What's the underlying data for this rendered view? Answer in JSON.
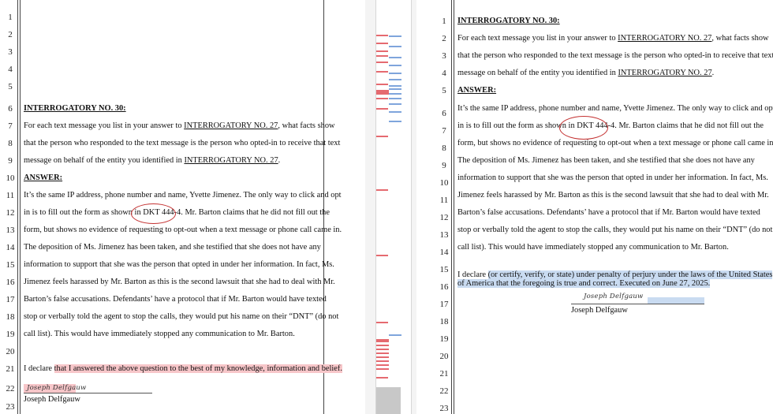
{
  "left": {
    "line_numbers": [
      "1",
      "2",
      "3",
      "4",
      "5",
      "6",
      "7",
      "8",
      "9",
      "10",
      "11",
      "12",
      "13",
      "14",
      "15",
      "16",
      "17",
      "18",
      "19",
      "20",
      "21",
      "22",
      "23"
    ],
    "heading": "INTERROGATORY NO. 30:",
    "q1_pre": "For each text message you list in your answer to ",
    "q1_ref": "INTERROGATORY NO. 27",
    "q1_post": ", what facts show",
    "q2": "that the person who responded to the text message is the person who opted-in to receive that text",
    "q3_pre": "message on behalf of the entity you identified in ",
    "q3_ref": "INTERROGATORY NO. 27",
    "q3_post": ".",
    "answer_heading": "ANSWER:",
    "a1": "It’s the same IP address, phone number and name, Yvette Jimenez. The only way to click and opt",
    "a2_pre": "in is to fill out the form as shown in ",
    "a2_ref": "DKT 444-4.",
    "a2_post": "  Mr. Barton claims that he did not fill out the",
    "a3": "form, but shows no evidence of requesting to opt-out when a text message or phone call came in.",
    "a4": "The deposition of Ms. Jimenez has been taken, and she testified that she does not have any",
    "a5": "information to support that she was the person that opted in under her information.  In fact, Ms.",
    "a6": "Jimenez feels harassed by Mr. Barton as this is the second lawsuit that she had to deal with Mr.",
    "a7": "Barton’s false accusations.    Defendants’ have a protocol that if Mr. Barton would have texted",
    "a8": "stop or verbally told the agent to stop the calls, they would put his name on their “DNT” (do not",
    "a9": "call list). This would have immediately stopped any communication to Mr. Barton.",
    "declare_pre": "I declare ",
    "declare_hl": "that I answered the above question to the best of my knowledge, information and belief.",
    "signature": "Joseph Delfgauw",
    "signer": "Joseph Delfgauw"
  },
  "right": {
    "line_numbers": [
      "1",
      "2",
      "3",
      "4",
      "5",
      "6",
      "7",
      "8",
      "9",
      "10",
      "11",
      "12",
      "13",
      "14",
      "15",
      "16",
      "17",
      "18",
      "19",
      "20",
      "21",
      "22",
      "23"
    ],
    "heading": "INTERROGATORY NO. 30:",
    "q1_pre": "For each text message you list in your answer to ",
    "q1_ref": "INTERROGATORY NO. 27",
    "q1_post": ", what facts show",
    "q2": "that the person who responded to the text message is the person who opted-in to receive that text",
    "q3_pre": "message on behalf of the entity you identified in ",
    "q3_ref": "INTERROGATORY NO. 27",
    "q3_post": ".",
    "answer_heading": "ANSWER:",
    "a1": "It’s the same IP address, phone number and name, Yvette Jimenez. The only way to click and opt",
    "a2_pre": "in is to fill out the form as shown in ",
    "a2_ref": "DKT 444-4.",
    "a2_post": "  Mr. Barton claims that he did not fill out the",
    "a3": "form, but shows no evidence of requesting to opt-out when a text message or phone call came in.",
    "a4": "The deposition of Ms. Jimenez has been taken, and she testified that she does not have any",
    "a5": "information to support that she was the person that opted in under her information.  In fact, Ms.",
    "a6": "Jimenez feels harassed by Mr. Barton as this is the second lawsuit that she had to deal with Mr.",
    "a7": "Barton’s false accusations.    Defendants’ have a protocol that if Mr. Barton would have texted",
    "a8": "stop or verbally told the agent to stop the calls, they would put his name on their “DNT” (do not",
    "a9": "call list). This would have immediately stopped any communication to Mr. Barton.",
    "declare_pre": "I declare ",
    "declare_hl": "(or certify, verify, or state) under penalty of perjury under the laws of the United States",
    "declare_hl2": "of America that the foregoing is true and correct. Executed on June 27, 2025.",
    "signature": "Joseph Delfgauw",
    "signer": "Joseph Delfgauw"
  },
  "colors": {
    "deleted_highlight": "#f7c6c9",
    "added_highlight": "#c9dbf1",
    "circle": "#c43232",
    "strip_removed": "#e56a70",
    "strip_added": "#7fa5dc"
  }
}
